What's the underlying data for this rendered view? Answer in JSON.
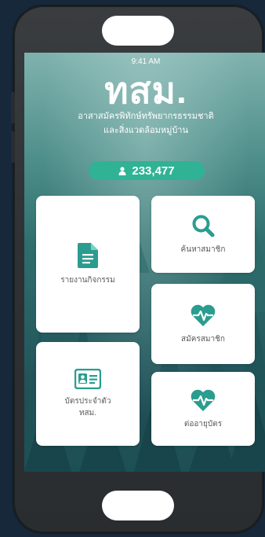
{
  "status_bar": {
    "time": "9:41 AM"
  },
  "header": {
    "logo_text": "ทสม.",
    "subtitle_line1": "อาสาสมัครพิทักษ์ทรัพยากรธรรมชาติ",
    "subtitle_line2": "และสิ่งแวดล้อมหมู่บ้าน"
  },
  "member_count": {
    "icon": "person-icon",
    "value": "233,477"
  },
  "menu": {
    "report_activity": {
      "label": "รายงานกิจกรรม",
      "icon": "document-icon"
    },
    "search_member": {
      "label": "ค้นหาสมาชิก",
      "icon": "search-icon"
    },
    "apply_member": {
      "label": "สมัครสมาชิก",
      "icon": "heartbeat-icon"
    },
    "id_card": {
      "label_line1": "บัตรประจำตัว",
      "label_line2": "ทสม.",
      "icon": "id-card-icon"
    },
    "renew_card": {
      "label": "ต่ออายุบัตร",
      "icon": "heartbeat-icon"
    }
  },
  "colors": {
    "accent": "#2fb394",
    "icon_teal": "#2a9d8f",
    "background": "#16283a",
    "phone_body": "#2e3134"
  }
}
